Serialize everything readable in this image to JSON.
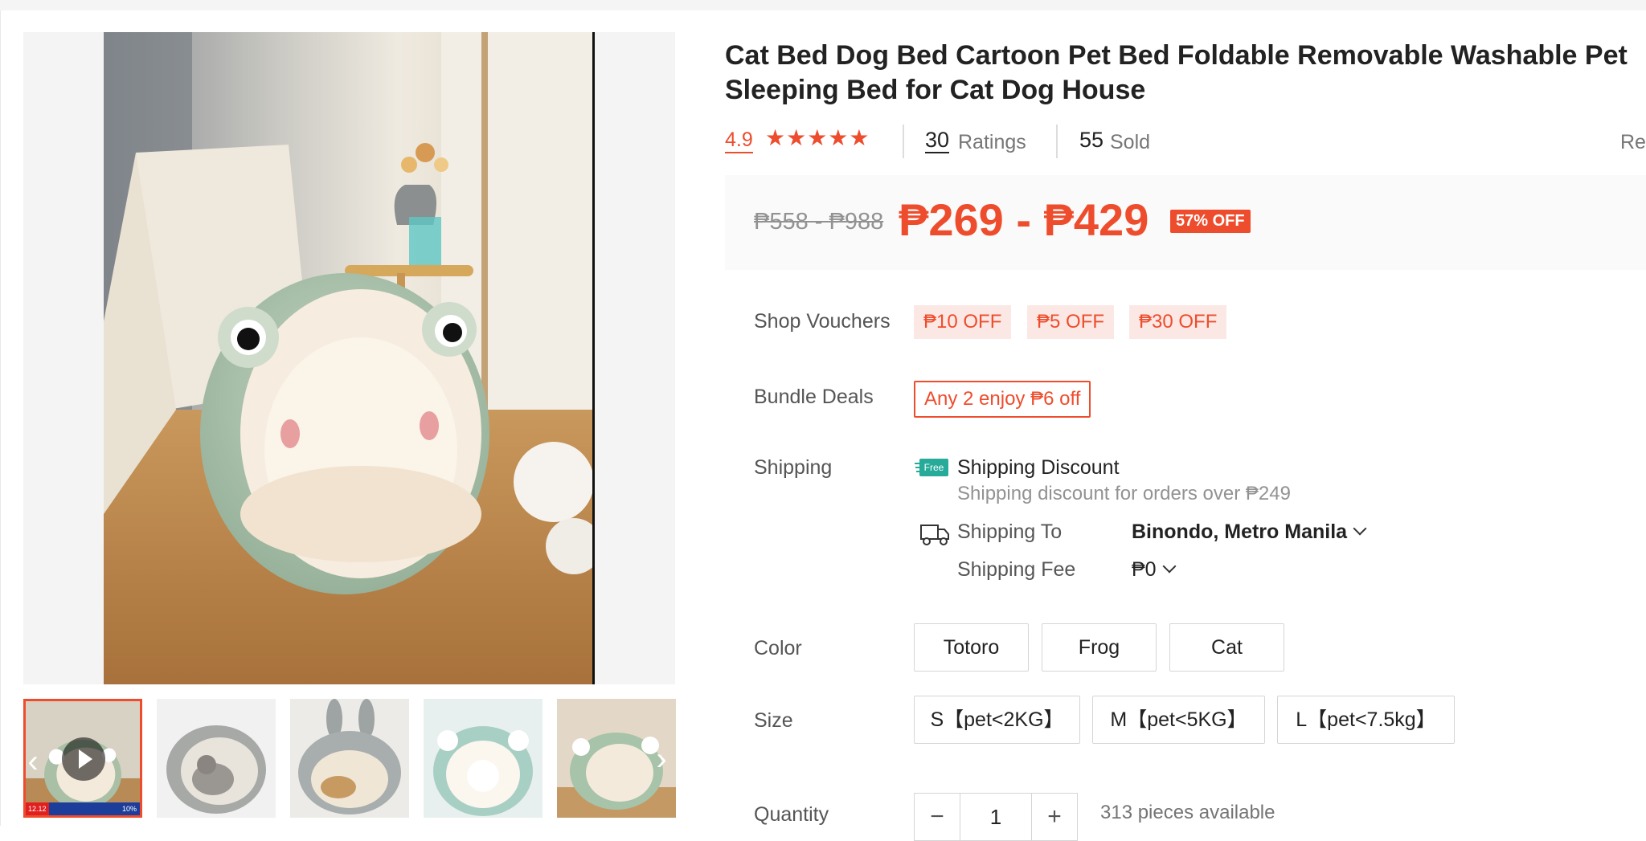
{
  "product": {
    "title": "Cat Bed Dog Bed Cartoon Pet Bed Foldable Removable Washable Pet Sleeping Bed for Cat Dog House",
    "rating": "4.9",
    "stars_filled": 5,
    "ratings_count": "30",
    "ratings_label": "Ratings",
    "sold_count": "55",
    "sold_label": "Sold",
    "report_label": "Rep"
  },
  "price": {
    "original": "₱558 - ₱988",
    "sale": "₱269 - ₱429",
    "discount": "57% OFF"
  },
  "vouchers": {
    "label": "Shop Vouchers",
    "items": [
      "₱10 OFF",
      "₱5 OFF",
      "₱30 OFF"
    ]
  },
  "bundle": {
    "label": "Bundle Deals",
    "deal": "Any 2 enjoy ₱6 off"
  },
  "shipping": {
    "label": "Shipping",
    "free_badge": "Free",
    "discount_title": "Shipping Discount",
    "discount_sub": "Shipping discount for orders over ₱249",
    "to_label": "Shipping To",
    "to_value": "Binondo, Metro Manila",
    "fee_label": "Shipping Fee",
    "fee_value": "₱0"
  },
  "color": {
    "label": "Color",
    "options": [
      "Totoro",
      "Frog",
      "Cat"
    ]
  },
  "size": {
    "label": "Size",
    "options": [
      "S【pet<2KG】",
      "M【pet<5KG】",
      "L【pet<7.5kg】"
    ]
  },
  "quantity": {
    "label": "Quantity",
    "value": "1",
    "minus": "−",
    "plus": "+",
    "available": "313 pieces available"
  },
  "thumbnails": {
    "active_index": 0,
    "badge_date": "12.12",
    "badge_text": "10%"
  },
  "colors": {
    "accent": "#ee4d2d",
    "price_bg": "#fafafa",
    "voucher_bg": "#fbe8e4"
  }
}
